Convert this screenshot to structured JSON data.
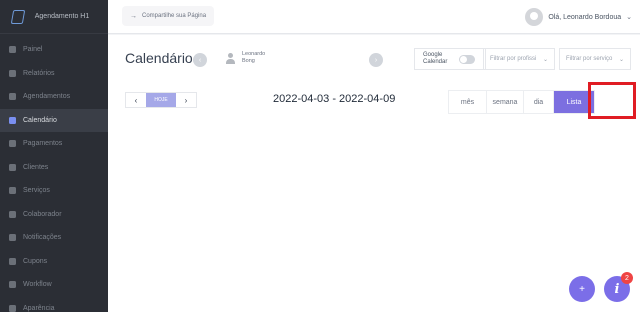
{
  "app": {
    "brand": "Agendamento H1",
    "menu": [
      {
        "label": "Painel",
        "icon": "dashboard-icon",
        "active": false
      },
      {
        "label": "Relatórios",
        "icon": "reports-icon",
        "active": false
      },
      {
        "label": "Agendamentos",
        "icon": "clock-icon",
        "active": false
      },
      {
        "label": "Calendário",
        "icon": "calendar-icon",
        "active": true
      },
      {
        "label": "Pagamentos",
        "icon": "payment-icon",
        "active": false
      },
      {
        "label": "Clientes",
        "icon": "users-icon",
        "active": false
      },
      {
        "label": "Serviços",
        "icon": "services-icon",
        "active": false
      },
      {
        "label": "Colaborador",
        "icon": "person-icon",
        "active": false
      },
      {
        "label": "Notificações",
        "icon": "send-icon",
        "active": false
      },
      {
        "label": "Cupons",
        "icon": "tag-icon",
        "active": false
      },
      {
        "label": "Workflow",
        "icon": "workflow-icon",
        "active": false
      },
      {
        "label": "Aparência",
        "icon": "brush-icon",
        "active": false
      }
    ]
  },
  "topbar": {
    "share_label": "Compartilhe sua Página",
    "share_icon": "share-arrow-icon",
    "user_name": "Olá, Leonardo Bordoua"
  },
  "calendar": {
    "title": "Calendário",
    "professional": "Leonardo Bong",
    "google_calendar_label": "Google Calendar",
    "filter_professional": "Filtrar por profissi",
    "filter_service": "Filtrar por serviço",
    "today_label": "HOJE",
    "prev_label": "‹",
    "next_label": "›",
    "range": "2022-04-03 - 2022-04-09",
    "views": [
      "mês",
      "semana",
      "dia",
      "Lista"
    ],
    "active_view": "Lista"
  },
  "fab": {
    "plus_label": "+",
    "info_label": "i",
    "notification_count": "2"
  },
  "colors": {
    "accent": "#7c6fe0",
    "sidebar_bg": "#2b2e35",
    "highlight": "#e01c23"
  }
}
